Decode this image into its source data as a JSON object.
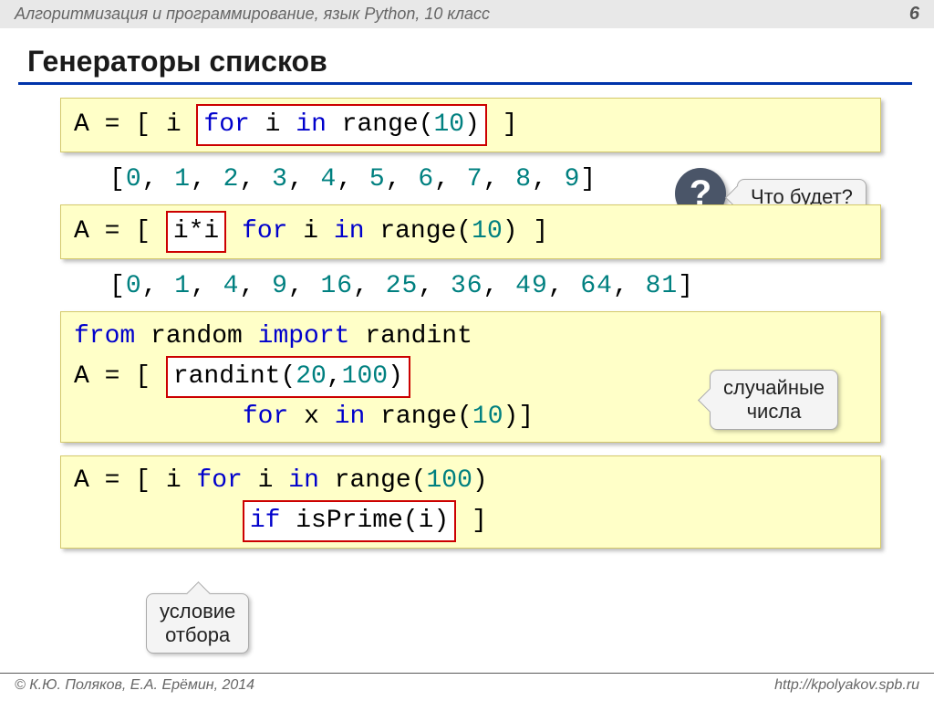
{
  "header": {
    "breadcrumb": "Алгоритмизация и программирование, язык Python, 10 класс",
    "page": "6"
  },
  "title": "Генераторы списков",
  "code1": {
    "prefix": "A = [ i ",
    "boxed": "for i in range(10)",
    "suffix": " ]"
  },
  "result1": "[0, 1, 2, 3, 4, 5, 6, 7, 8, 9]",
  "question_label": "Что будет?",
  "code2": {
    "prefix": "A = [ ",
    "boxed": "i*i",
    "suffix": " for i in range(10) ]"
  },
  "result2": "[0, 1, 4, 9, 16, 25, 36, 49, 64, 81]",
  "code3": {
    "line1_kw1": "from",
    "line1_mid": " random ",
    "line1_kw2": "import",
    "line1_end": " randint",
    "line2_prefix": "A = [ ",
    "line2_boxed_fn": "randint",
    "line2_boxed_paren_open": "(",
    "line2_boxed_args": "20,100",
    "line2_boxed_paren_close": ")",
    "line3_indent": "           ",
    "line3_kw": "for",
    "line3_mid": " x ",
    "line3_kw2": "in",
    "line3_end": " range(10)]"
  },
  "callout_random": "случайные\nчисла",
  "code4": {
    "line1_prefix": "A = [ i ",
    "line1_kw": "for",
    "line1_mid": " i ",
    "line1_kw2": "in",
    "line1_fn": " range",
    "line1_paren": "(",
    "line1_num": "100",
    "line1_close": ")",
    "line2_indent": "           ",
    "line2_kw": "if",
    "line2_rest": " isPrime(i) ]"
  },
  "callout_filter": "условие\nотбора",
  "footer": {
    "left": "© К.Ю. Поляков, Е.А. Ерёмин, 2014",
    "right": "http://kpolyakov.spb.ru"
  }
}
